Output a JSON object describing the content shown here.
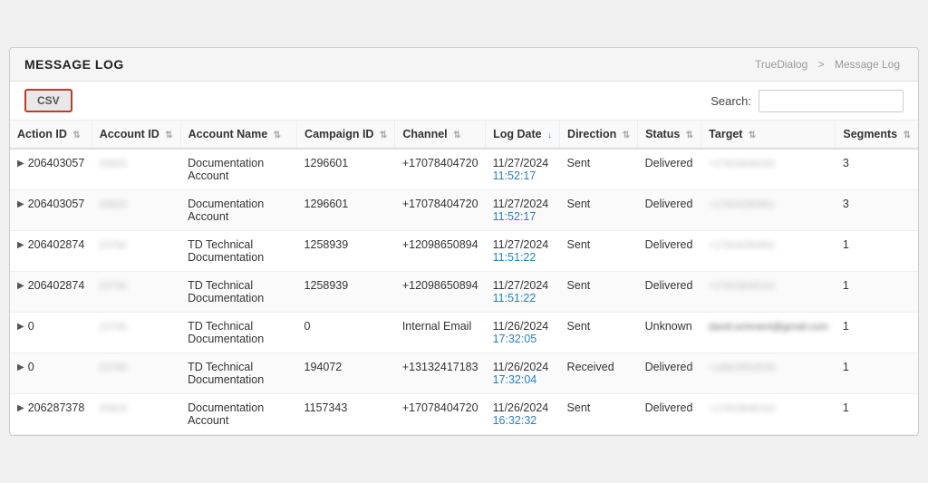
{
  "header": {
    "title": "MESSAGE LOG",
    "breadcrumb": {
      "root": "TrueDialog",
      "separator": ">",
      "current": "Message Log"
    }
  },
  "toolbar": {
    "csv_label": "CSV",
    "search_label": "Search:",
    "search_placeholder": ""
  },
  "table": {
    "columns": [
      {
        "key": "action_id",
        "label": "Action ID",
        "sortable": true
      },
      {
        "key": "account_id",
        "label": "Account ID",
        "sortable": true
      },
      {
        "key": "account_name",
        "label": "Account Name",
        "sortable": true
      },
      {
        "key": "campaign_id",
        "label": "Campaign ID",
        "sortable": true
      },
      {
        "key": "channel",
        "label": "Channel",
        "sortable": true
      },
      {
        "key": "log_date",
        "label": "Log Date",
        "sortable": true,
        "active": true
      },
      {
        "key": "direction",
        "label": "Direction",
        "sortable": true
      },
      {
        "key": "status",
        "label": "Status",
        "sortable": true
      },
      {
        "key": "target",
        "label": "Target",
        "sortable": true
      },
      {
        "key": "segments",
        "label": "Segments",
        "sortable": true
      }
    ],
    "rows": [
      {
        "action_id": "206403057",
        "account_id": "25825",
        "account_name": "Documentation Account",
        "campaign_id": "1296601",
        "channel": "+17078404720",
        "log_date": "11/27/2024 11:52:17",
        "direction": "Sent",
        "status": "Delivered",
        "target": "+17603848162",
        "segments": "3"
      },
      {
        "action_id": "206403057",
        "account_id": "25825",
        "account_name": "Documentation Account",
        "campaign_id": "1296601",
        "channel": "+17078404720",
        "log_date": "11/27/2024 11:52:17",
        "direction": "Sent",
        "status": "Delivered",
        "target": "+17604280951",
        "segments": "3"
      },
      {
        "action_id": "206402874",
        "account_id": "23790",
        "account_name": "TD Technical Documentation",
        "campaign_id": "1258939",
        "channel": "+12098650894",
        "log_date": "11/27/2024 11:51:22",
        "direction": "Sent",
        "status": "Delivered",
        "target": "+17604280951",
        "segments": "1"
      },
      {
        "action_id": "206402874",
        "account_id": "23790",
        "account_name": "TD Technical Documentation",
        "campaign_id": "1258939",
        "channel": "+12098650894",
        "log_date": "11/27/2024 11:51:22",
        "direction": "Sent",
        "status": "Delivered",
        "target": "+17603848162",
        "segments": "1"
      },
      {
        "action_id": "0",
        "account_id": "23790",
        "account_name": "TD Technical Documentation",
        "campaign_id": "0",
        "channel": "Internal Email",
        "log_date": "11/26/2024 17:32:05",
        "direction": "Sent",
        "status": "Unknown",
        "target": "david.schment@gmail.com",
        "segments": "1"
      },
      {
        "action_id": "0",
        "account_id": "23790",
        "account_name": "TD Technical Documentation",
        "campaign_id": "194072",
        "channel": "+13132417183",
        "log_date": "11/26/2024 17:32:04",
        "direction": "Received",
        "status": "Delivered",
        "target": "+18603562530",
        "segments": "1"
      },
      {
        "action_id": "206287378",
        "account_id": "25825",
        "account_name": "Documentation Account",
        "campaign_id": "1157343",
        "channel": "+17078404720",
        "log_date": "11/26/2024 16:32:32",
        "direction": "Sent",
        "status": "Delivered",
        "target": "+17603848162",
        "segments": "1"
      }
    ]
  }
}
